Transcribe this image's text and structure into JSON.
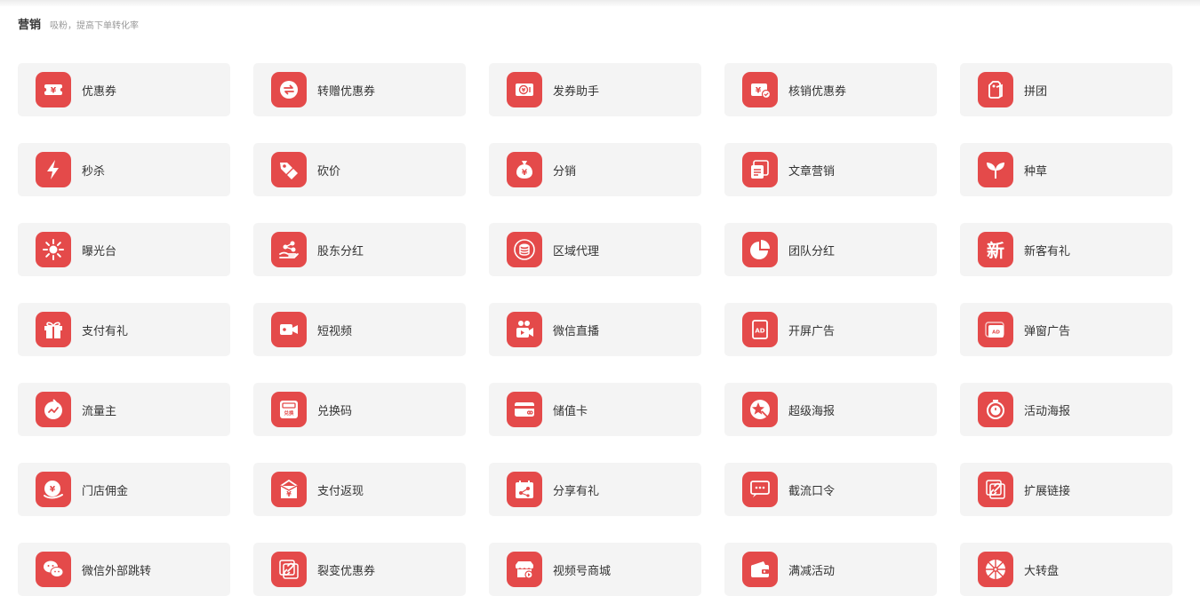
{
  "section": {
    "title": "营销",
    "subtitle": "吸粉，提高下单转化率"
  },
  "theme": {
    "accent": "#e44a4a",
    "card_bg": "#f4f4f4"
  },
  "items": [
    {
      "label": "优惠券",
      "icon": "coupon-icon"
    },
    {
      "label": "转赠优惠券",
      "icon": "transfer-icon"
    },
    {
      "label": "发券助手",
      "icon": "coupon-helper-icon"
    },
    {
      "label": "核销优惠券",
      "icon": "coupon-verify-icon"
    },
    {
      "label": "拼团",
      "icon": "group-buy-icon"
    },
    {
      "label": "秒杀",
      "icon": "lightning-icon"
    },
    {
      "label": "砍价",
      "icon": "price-tag-icon"
    },
    {
      "label": "分销",
      "icon": "money-bag-icon"
    },
    {
      "label": "文章营销",
      "icon": "article-icon"
    },
    {
      "label": "种草",
      "icon": "sprout-icon"
    },
    {
      "label": "曝光台",
      "icon": "sun-icon"
    },
    {
      "label": "股东分红",
      "icon": "hand-share-icon"
    },
    {
      "label": "区域代理",
      "icon": "coin-stack-icon"
    },
    {
      "label": "团队分红",
      "icon": "pie-chart-icon"
    },
    {
      "label": "新客有礼",
      "icon": "new-customer-icon"
    },
    {
      "label": "支付有礼",
      "icon": "gift-icon"
    },
    {
      "label": "短视频",
      "icon": "video-camera-icon"
    },
    {
      "label": "微信直播",
      "icon": "live-stream-icon"
    },
    {
      "label": "开屏广告",
      "icon": "splash-ad-icon"
    },
    {
      "label": "弹窗广告",
      "icon": "popup-ad-icon"
    },
    {
      "label": "流量主",
      "icon": "traffic-icon"
    },
    {
      "label": "兑换码",
      "icon": "redeem-code-icon"
    },
    {
      "label": "储值卡",
      "icon": "card-icon"
    },
    {
      "label": "超级海报",
      "icon": "poster-star-icon"
    },
    {
      "label": "活动海报",
      "icon": "timer-icon"
    },
    {
      "label": "门店佣金",
      "icon": "store-commission-icon"
    },
    {
      "label": "支付返现",
      "icon": "cashback-icon"
    },
    {
      "label": "分享有礼",
      "icon": "share-calendar-icon"
    },
    {
      "label": "截流口令",
      "icon": "chat-command-icon"
    },
    {
      "label": "扩展链接",
      "icon": "link-icon"
    },
    {
      "label": "微信外部跳转",
      "icon": "wechat-icon"
    },
    {
      "label": "裂变优惠券",
      "icon": "fission-link-icon"
    },
    {
      "label": "视频号商城",
      "icon": "video-shop-icon"
    },
    {
      "label": "满减活动",
      "icon": "wallet-icon"
    },
    {
      "label": "大转盘",
      "icon": "wheel-icon"
    }
  ]
}
